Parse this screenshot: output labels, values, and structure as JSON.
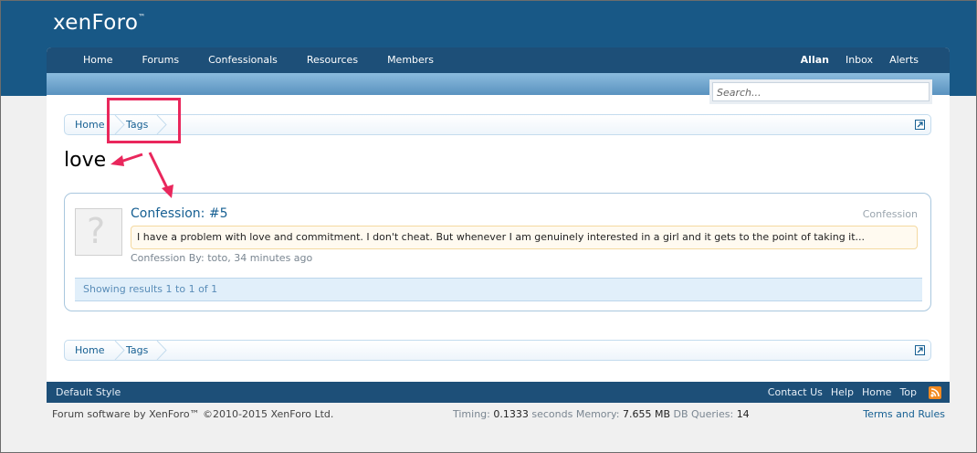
{
  "header": {
    "logo": "xenForo",
    "logo_tm": "™"
  },
  "nav": {
    "left": [
      "Home",
      "Forums",
      "Confessionals",
      "Resources",
      "Members"
    ],
    "right": [
      "Allan",
      "Inbox",
      "Alerts"
    ]
  },
  "search": {
    "placeholder": "Search..."
  },
  "breadcrumb": {
    "home": "Home",
    "tags": "Tags"
  },
  "page_title": "love",
  "result": {
    "title": "Confession: #5",
    "type": "Confession",
    "snippet": "I have a problem with love and commitment. I don't cheat. But whenever I am genuinely interested in a girl and it gets to the point of taking it...",
    "meta_prefix": "Confession By: ",
    "author": "toto",
    "time": ", 34 minutes ago",
    "showing": "Showing results 1 to 1 of 1"
  },
  "footer": {
    "style": "Default Style",
    "links": [
      "Contact Us",
      "Help",
      "Home",
      "Top"
    ],
    "copyright": "Forum software by XenForo™ ©2010-2015 XenForo Ltd.",
    "timing_label": "Timing: ",
    "timing_value": "0.1333",
    "timing_unit": " seconds Memory: ",
    "memory_value": "7.655 MB",
    "queries_label": " DB Queries: ",
    "queries_value": "14",
    "terms": "Terms and Rules"
  },
  "colors": {
    "header_bg": "#185886",
    "nav_bg": "#1d4f78",
    "link": "#176093",
    "highlight": "#e9275c"
  },
  "icons": [
    "rss-icon",
    "jump-icon",
    "default-avatar-icon"
  ]
}
